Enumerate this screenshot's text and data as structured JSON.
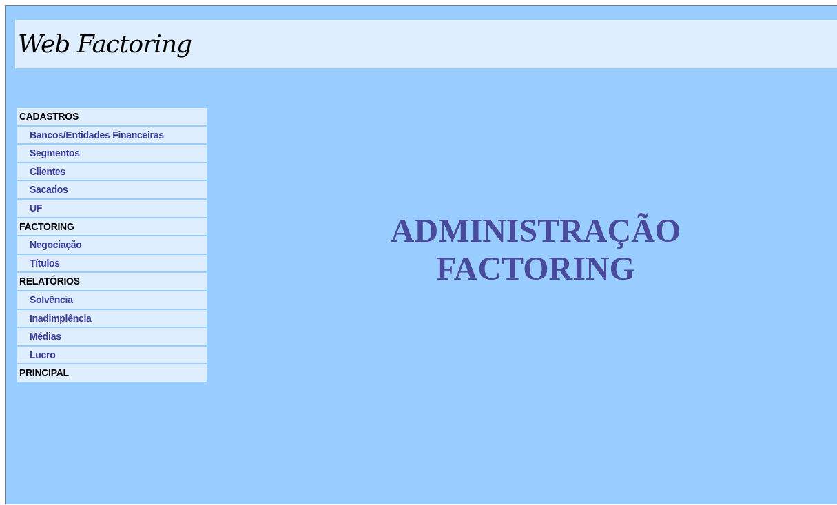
{
  "header": {
    "title": "Web Factoring"
  },
  "menu": [
    {
      "kind": "section",
      "label": "CADASTROS"
    },
    {
      "kind": "link",
      "label": "Bancos/Entidades Financeiras"
    },
    {
      "kind": "link",
      "label": "Segmentos"
    },
    {
      "kind": "link",
      "label": "Clientes"
    },
    {
      "kind": "link",
      "label": "Sacados"
    },
    {
      "kind": "link",
      "label": "UF"
    },
    {
      "kind": "section",
      "label": "FACTORING"
    },
    {
      "kind": "link",
      "label": "Negociação"
    },
    {
      "kind": "link",
      "label": "Títulos"
    },
    {
      "kind": "section",
      "label": "RELATÓRIOS"
    },
    {
      "kind": "link",
      "label": "Solvência"
    },
    {
      "kind": "link",
      "label": "Inadimplência"
    },
    {
      "kind": "link",
      "label": "Médias"
    },
    {
      "kind": "link",
      "label": "Lucro"
    },
    {
      "kind": "section",
      "label": "PRINCIPAL"
    }
  ],
  "main": {
    "title_lines": [
      "ADMINISTRAÇÃO",
      "FACTORING"
    ]
  }
}
